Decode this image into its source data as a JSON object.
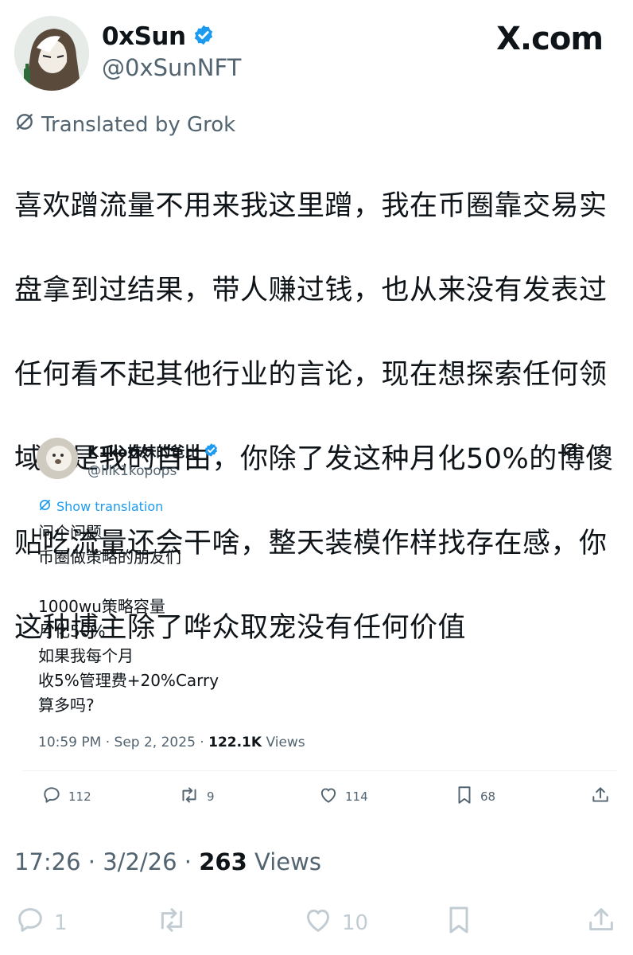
{
  "author": {
    "display_name": "0xSun",
    "handle": "@0xSunNFT",
    "verified_icon": "verified-badge-icon",
    "verified_color": "#1d9bf0"
  },
  "brand": {
    "site": "X.com"
  },
  "translation_label": "Translated by Grok",
  "tweet_lines": [
    "喜欢蹭流量不用来我这里蹭，我在币圈靠交易实",
    "盘拿到过结果，带人赚过钱，也从来没有发表过",
    "任何看不起其他行业的言论，现在想探索任何领",
    "域都是我的自由，你除了发这种月化50%的博傻",
    "贴吃流量还会干啥，整天装模作样找存在感，你",
    "这种博主除了哗众取宠没有任何价值"
  ],
  "quoted": {
    "display_name": "K1ko妹妹的爸比",
    "handle": "@lilk1kopops",
    "show_translation": "Show translation",
    "lines": [
      "问个问题",
      "币圈做策略的朋友们",
      "",
      "1000wu策略容量",
      "月化50%",
      "如果我每个月",
      "收5%管理费+20%Carry",
      "算多吗?"
    ],
    "time": "10:59 PM",
    "date": "Sep 2, 2025",
    "views_count": "122.1K",
    "views_label": "Views",
    "replies": "112",
    "reposts": "9",
    "likes": "114",
    "bookmarks": "68"
  },
  "meta": {
    "time": "17:26",
    "date": "3/2/26",
    "views_count": "263",
    "views_label": "Views"
  },
  "actions": {
    "replies": "1",
    "reposts": "",
    "likes": "10",
    "bookmarks": ""
  },
  "colors": {
    "text": "#0f1419",
    "secondary": "#536471",
    "accent": "#1d9bf0",
    "faded_icons": "#c2cdd3"
  }
}
